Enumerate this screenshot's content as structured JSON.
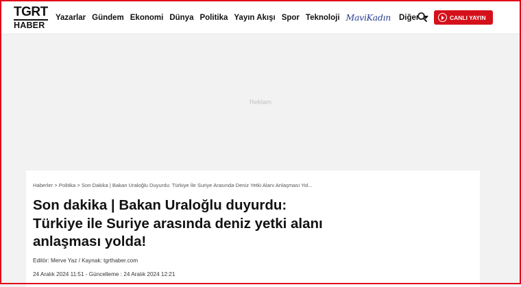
{
  "header": {
    "logo": {
      "top": "TGRT",
      "bottom": "HABER"
    },
    "nav": [
      "Yazarlar",
      "Gündem",
      "Ekonomi",
      "Dünya",
      "Politika",
      "Yayın Akışı",
      "Spor",
      "Teknoloji"
    ],
    "brand_link": "MaviKadın",
    "more_label": "Diğer",
    "live_label": "CANLI YAYIN"
  },
  "ad": {
    "label": "Reklam"
  },
  "article": {
    "breadcrumb": "Haberler > Politika > Son Dakika | Bakan Uraloğlu Duyurdu: Türkiye İle Suriye Arasında Deniz Yetki Alanı Anlaşması Yol...",
    "title": "Son dakika | Bakan Uraloğlu duyurdu: Türkiye ile Suriye arasında deniz yetki alanı anlaşması yolda!",
    "editor": "Editör: Merve Yaz / Kaynak: tgrthaber.com",
    "dates": "24 Aralık 2024 11:51 - Güncelleme : 24 Aralık 2024 12:21"
  },
  "colors": {
    "accent": "#d4111b",
    "brand_blue": "#2a3f8f"
  }
}
